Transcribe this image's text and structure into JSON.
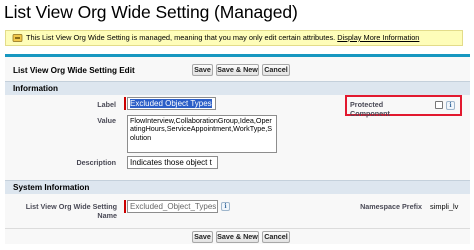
{
  "page": {
    "title": "List View Org Wide Setting (Managed)"
  },
  "notice": {
    "text": "This List View Org Wide Setting is managed, meaning that you may only edit certain attributes.",
    "link_label": "Display More Information"
  },
  "edit_form": {
    "title": "List View Org Wide Setting Edit",
    "save_label": "Save",
    "save_new_label": "Save & New",
    "cancel_label": "Cancel"
  },
  "information": {
    "header": "Information",
    "label_field_label": "Label",
    "label_field_value": "Excluded Object Types",
    "value_field_label": "Value",
    "value_field_value": "FlowInterview,CollaborationGroup,Idea,OperatingHours,ServiceAppointment,WorkType,Solution",
    "description_field_label": "Description",
    "description_field_value": "Indicates those object t",
    "protected_component_label": "Protected Component",
    "protected_component_checked": false
  },
  "system_information": {
    "header": "System Information",
    "name_field_label": "List View Org Wide Setting Name",
    "name_field_value": "Excluded_Object_Types",
    "namespace_label": "Namespace Prefix",
    "namespace_value": "simpli_lv"
  },
  "icons": {
    "notice": "lock-icon",
    "info": "info-icon"
  },
  "colors": {
    "accent": "#1797c0",
    "notice_bg": "#fefdb9",
    "section_bg": "#dde6ef",
    "highlight": "#e2192f",
    "required": "#cc0000"
  }
}
